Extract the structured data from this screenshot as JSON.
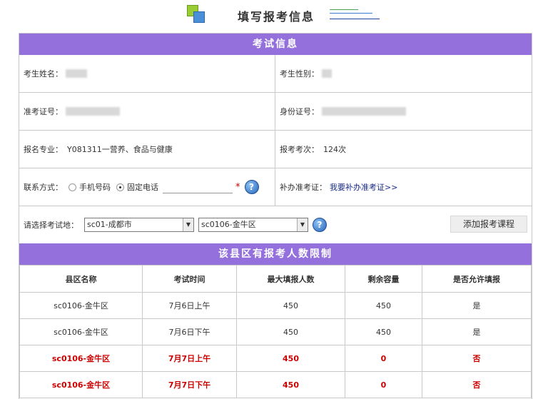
{
  "page": {
    "title": "填写报考信息"
  },
  "exam_info": {
    "header": "考试信息",
    "name_label": "考生姓名：",
    "gender_label": "考生性别：",
    "ticket_label": "准考证号：",
    "id_label": "身份证号：",
    "major_label": "报名专业：",
    "major_value": "Y081311一营养、食品与健康",
    "count_label": "报考考次：",
    "count_value": "124次",
    "contact_label": "联系方式：",
    "contact_options": [
      "手机号码",
      "固定电话"
    ],
    "contact_selected": "固定电话",
    "required_mark": "*",
    "help_glyph": "?",
    "reissue_label": "补办准考证：",
    "reissue_link": "我要补办准考证>>",
    "location_label": "请选择考试地：",
    "city_select": "sc01-成都市",
    "district_select": "sc0106-金牛区",
    "add_course_button": "添加报考课程"
  },
  "limits": {
    "header": "该县区有报考人数限制",
    "columns": [
      "县区名称",
      "考试时间",
      "最大填报人数",
      "剩余容量",
      "是否允许填报"
    ],
    "rows": [
      {
        "district": "sc0106-金牛区",
        "time": "7月6日上午",
        "max": "450",
        "remaining": "450",
        "allowed": "是",
        "status": "open"
      },
      {
        "district": "sc0106-金牛区",
        "time": "7月6日下午",
        "max": "450",
        "remaining": "450",
        "allowed": "是",
        "status": "open"
      },
      {
        "district": "sc0106-金牛区",
        "time": "7月7日上午",
        "max": "450",
        "remaining": "0",
        "allowed": "否",
        "status": "denied"
      },
      {
        "district": "sc0106-金牛区",
        "time": "7月7日下午",
        "max": "450",
        "remaining": "0",
        "allowed": "否",
        "status": "denied"
      }
    ]
  },
  "colors": {
    "section_header": "#9370db",
    "denied_text": "#cc0000",
    "border": "#c9c9c9"
  },
  "icons": {
    "logo": "squares-logo-icon",
    "help": "help-question-icon",
    "dropdown": "chevron-down-icon"
  }
}
